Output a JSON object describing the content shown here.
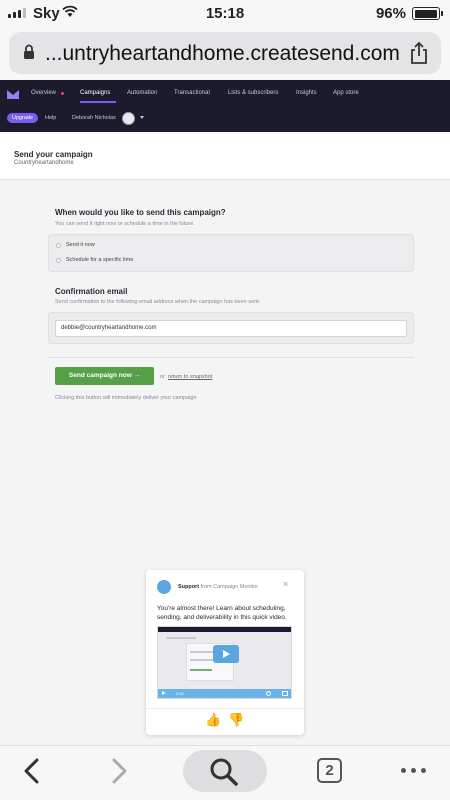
{
  "status_bar": {
    "carrier": "Sky",
    "time": "15:18",
    "battery_percent": "96%",
    "battery_level": 0.96,
    "icons": [
      "signal-icon",
      "wifi-icon",
      "battery-icon"
    ]
  },
  "browser": {
    "url": "...untryheartandhome.createsend.com",
    "tab_count": "2",
    "icons": [
      "lock-icon",
      "share-icon",
      "back-icon",
      "forward-icon",
      "search-icon",
      "tabs-icon",
      "more-icon"
    ]
  },
  "nav": {
    "items": [
      {
        "label": "Overview"
      },
      {
        "label": "Campaigns"
      },
      {
        "label": "Automation"
      },
      {
        "label": "Transactional"
      },
      {
        "label": "Lists & subscribers"
      },
      {
        "label": "Insights"
      },
      {
        "label": "App store"
      }
    ],
    "active": "Campaigns",
    "upgrade_label": "Upgrade",
    "help_label": "Help",
    "user_name": "Deborah Nicholas",
    "accent_color": "#7a5cf0",
    "background_color": "#1c1b2e"
  },
  "page": {
    "title": "Send your campaign",
    "subtitle": "Countryheartandhome"
  },
  "schedule": {
    "title": "When would you like to send this campaign?",
    "description": "You can send it right now or schedule a time in the future.",
    "options": [
      {
        "label": "Send it now"
      },
      {
        "label": "Schedule for a specific time"
      }
    ]
  },
  "confirmation": {
    "title": "Confirmation email",
    "description": "Send confirmation to the following email address when the campaign has been sent.",
    "email": "debbie@countryheartandhome.com"
  },
  "actions": {
    "send_label": "Send campaign now →",
    "or_text": "or",
    "snapshot_label": "return to snapshot",
    "note": "Clicking this button will immediately deliver your campaign",
    "send_color": "#56a047"
  },
  "support_popup": {
    "source": "Support",
    "from_text": "from Campaign Monitor",
    "message": "You're almost there! Learn about scheduling, sending, and deliverability in this quick video.",
    "close_glyph": "×",
    "video_time": "0:00",
    "thumbs_up": "👍",
    "thumbs_down": "👎"
  }
}
